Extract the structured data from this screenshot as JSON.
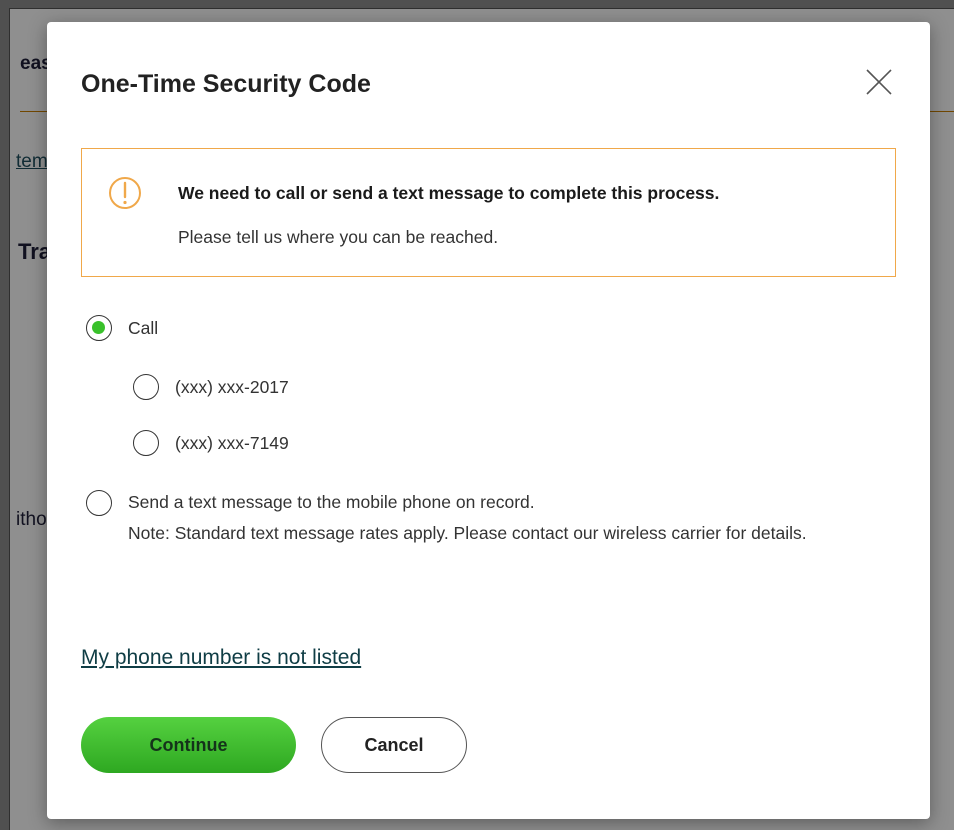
{
  "background": {
    "header_fragment": "eas",
    "link_fragment": "tem",
    "section_fragment": "Tra",
    "text_fragment": "itho"
  },
  "dialog": {
    "title": "One-Time Security Code",
    "close_icon": "close-icon",
    "alert": {
      "icon": "warning-icon",
      "title": "We need to call or send a text message to complete this process.",
      "body": "Please tell us where you can be reached."
    },
    "options": {
      "call_label": "Call",
      "call_selected": true,
      "phones": [
        "(xxx) xxx-2017",
        "(xxx) xxx-7149"
      ],
      "sms_line1": "Send a text message to the mobile phone on record.",
      "sms_line2": "Note: Standard text message rates apply. Please contact our wireless carrier for details."
    },
    "not_listed_link": "My phone number is not listed",
    "continue_label": "Continue",
    "cancel_label": "Cancel"
  },
  "colors": {
    "accent_green": "#39c12b",
    "alert_border": "#f0a84a",
    "link": "#0f3d45"
  }
}
